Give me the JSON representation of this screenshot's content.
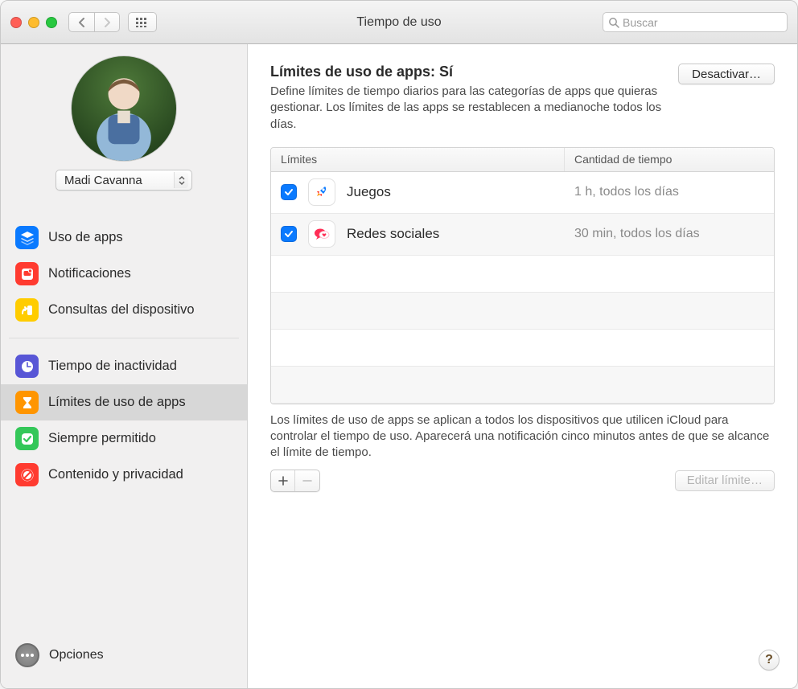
{
  "window": {
    "title": "Tiempo de uso",
    "search_placeholder": "Buscar"
  },
  "sidebar": {
    "user_name": "Madi Cavanna",
    "section1": [
      {
        "id": "uso-de-apps",
        "label": "Uso de apps",
        "icon": "layers-icon",
        "color": "#0a7aff"
      },
      {
        "id": "notificaciones",
        "label": "Notificaciones",
        "icon": "bell-square-icon",
        "color": "#ff3b30"
      },
      {
        "id": "consultas-dispositivo",
        "label": "Consultas del dispositivo",
        "icon": "pickup-icon",
        "color": "#ffcc00"
      }
    ],
    "section2": [
      {
        "id": "tiempo-inactividad",
        "label": "Tiempo de inactividad",
        "icon": "moon-clock-icon",
        "color": "#5856d6"
      },
      {
        "id": "limites-apps",
        "label": "Límites de uso de apps",
        "icon": "hourglass-icon",
        "color": "#ff9500"
      },
      {
        "id": "siempre-permitido",
        "label": "Siempre permitido",
        "icon": "check-shield-icon",
        "color": "#34c759"
      },
      {
        "id": "contenido-privacidad",
        "label": "Contenido y privacidad",
        "icon": "no-entry-icon",
        "color": "#ff3b30"
      }
    ],
    "selected": "limites-apps",
    "options_label": "Opciones"
  },
  "main": {
    "title_prefix": "Límites de uso de apps: ",
    "title_status": "Sí",
    "description": "Define límites de tiempo diarios para las categorías de apps que quieras gestionar. Los límites de las apps se restablecen a medianoche todos los días.",
    "deactivate_label": "Desactivar…",
    "table": {
      "col_limits": "Límites",
      "col_time": "Cantidad de tiempo",
      "rows": [
        {
          "checked": true,
          "name": "Juegos",
          "time": "1 h, todos los días",
          "icon": "rocket-icon",
          "bg": "#ffffff",
          "fg": "#0a7aff"
        },
        {
          "checked": true,
          "name": "Redes sociales",
          "time": "30 min, todos los días",
          "icon": "chat-heart-icon",
          "bg": "#ffffff",
          "fg": "#ff2d55"
        }
      ]
    },
    "footnote": "Los límites de uso de apps se aplican a todos los dispositivos que utilicen iCloud para controlar el tiempo de uso. Aparecerá una notificación cinco minutos antes de que se alcance el límite de tiempo.",
    "edit_label": "Editar límite…"
  }
}
